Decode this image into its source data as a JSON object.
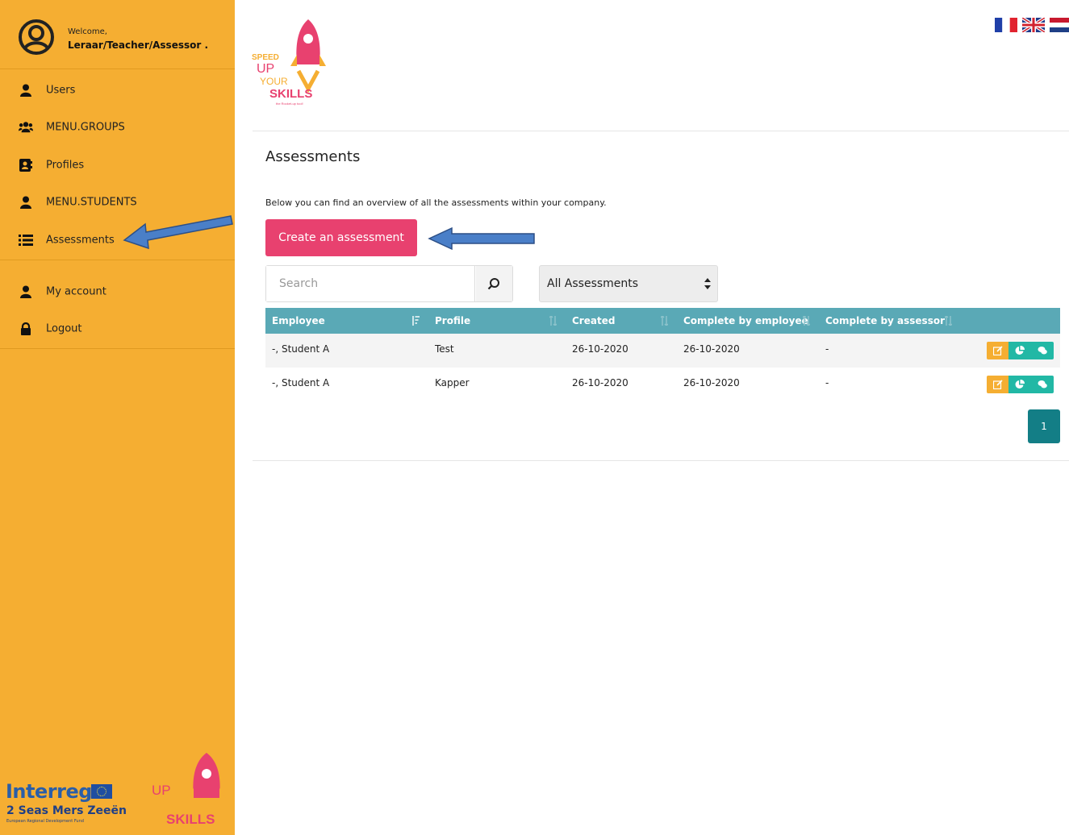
{
  "sidebar": {
    "welcome": "Welcome,",
    "username": "Leraar/Teacher/Assessor .",
    "items": [
      {
        "label": "Users",
        "icon": "user-icon"
      },
      {
        "label": "MENU.GROUPS",
        "icon": "group-icon"
      },
      {
        "label": "Profiles",
        "icon": "profile-card-icon"
      },
      {
        "label": "MENU.STUDENTS",
        "icon": "user-icon"
      },
      {
        "label": "Assessments",
        "icon": "list-icon"
      },
      {
        "label": "My account",
        "icon": "user-icon"
      },
      {
        "label": "Logout",
        "icon": "lock-icon"
      }
    ],
    "footer": {
      "interreg": "Interreg",
      "seas": "2 Seas Mers Zeeën",
      "seas_sub": "European Regional Development Fund"
    }
  },
  "logo": {
    "speed": "SPEED",
    "up": "UP",
    "your": "YOUR",
    "skills": "SKILLS",
    "tagline": "the Rocket-up tool!"
  },
  "languages": [
    "fr",
    "en",
    "nl"
  ],
  "main": {
    "title": "Assessments",
    "intro": "Below you can find an overview of all the assessments within your company.",
    "create_button": "Create an assessment",
    "search_placeholder": "Search",
    "filter_selected": "All Assessments",
    "table": {
      "headers": [
        "Employee",
        "Profile",
        "Created",
        "Complete by employee",
        "Complete by assessor"
      ],
      "rows": [
        {
          "employee": "-, Student A",
          "profile": "Test",
          "created": "26-10-2020",
          "complete_employee": "26-10-2020",
          "complete_assessor": "-"
        },
        {
          "employee": "-, Student A",
          "profile": "Kapper",
          "created": "26-10-2020",
          "complete_employee": "26-10-2020",
          "complete_assessor": "-"
        }
      ]
    },
    "pagination": {
      "current_page": "1"
    }
  },
  "colors": {
    "sidebar": "#f5ae32",
    "accent_pink": "#e8416f",
    "table_header": "#5aa9b6",
    "teal_button": "#22b8a5",
    "pagination": "#137e86"
  }
}
